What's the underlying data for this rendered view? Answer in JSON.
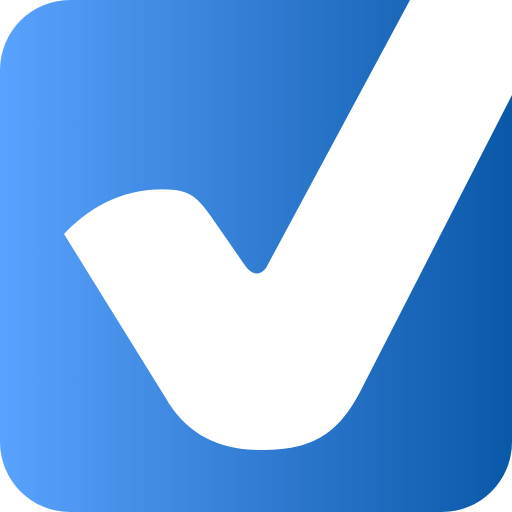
{
  "app_icon": {
    "name": "checkmark-app-icon",
    "colors": {
      "gradient_start": "#5aa2ff",
      "gradient_end": "#0a58a8",
      "checkmark": "#ffffff",
      "background": "#ffffff"
    }
  }
}
